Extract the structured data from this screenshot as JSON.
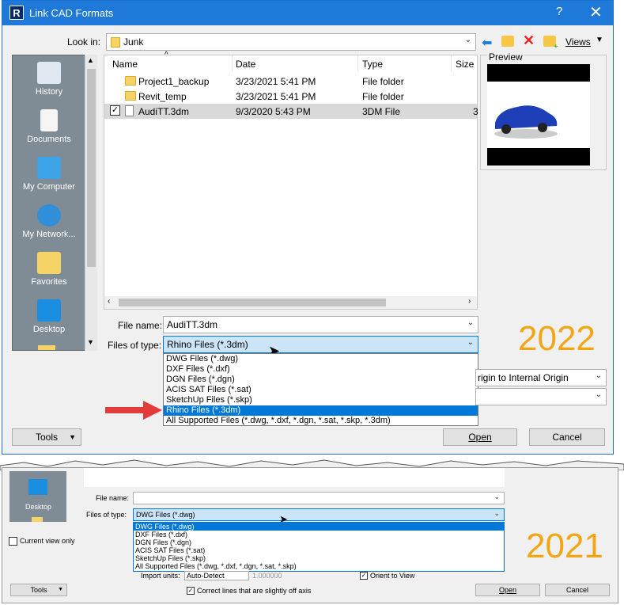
{
  "dialog2022": {
    "title": "Link CAD Formats",
    "help": "?",
    "close": "✕",
    "look_in_label": "Look in:",
    "look_in_value": "Junk",
    "views_label": "Views",
    "preview_label": "Preview",
    "places": [
      "History",
      "Documents",
      "My Computer",
      "My Network...",
      "Favorites",
      "Desktop"
    ],
    "columns": [
      "Name",
      "Date",
      "Type",
      "Size"
    ],
    "files": [
      {
        "name": "Project1_backup",
        "date": "3/23/2021 5:41 PM",
        "type": "File folder",
        "size": ""
      },
      {
        "name": "Revit_temp",
        "date": "3/23/2021 5:41 PM",
        "type": "File folder",
        "size": ""
      },
      {
        "name": "AudiTT.3dm",
        "date": "9/3/2020 5:43 PM",
        "type": "3DM File",
        "size": "3"
      }
    ],
    "file_name_label": "File name:",
    "file_name_value": "AudiTT.3dm",
    "files_of_type_label": "Files of type:",
    "files_of_type_value": "Rhino Files  (*.3dm)",
    "type_options": [
      "DWG Files  (*.dwg)",
      "DXF Files  (*.dxf)",
      "DGN Files  (*.dgn)",
      "ACIS SAT Files  (*.sat)",
      "SketchUp Files  (*.skp)",
      "Rhino Files  (*.3dm)",
      "All Supported Files  (*.dwg, *.dxf, *.dgn, *.sat, *.skp, *.3dm)"
    ],
    "positioning_value": "rigin to Internal Origin",
    "tools_label": "Tools",
    "open_label": "Open",
    "cancel_label": "Cancel",
    "year": "2022"
  },
  "dialog2021": {
    "place": "Desktop",
    "file_name_label": "File name:",
    "files_of_type_label": "Files of type:",
    "files_of_type_value": "DWG Files  (*.dwg)",
    "type_options": [
      "DWG Files  (*.dwg)",
      "DXF Files  (*.dxf)",
      "DGN Files  (*.dgn)",
      "ACIS SAT Files  (*.sat)",
      "SketchUp Files  (*.skp)",
      "All Supported Files  (*.dwg, *.dxf, *.dgn, *.sat, *.skp)"
    ],
    "current_view_only": "Current view only",
    "import_units_label": "Import units:",
    "import_units_value": "Auto-Detect",
    "scale_value": "1.000000",
    "orient_to_view": "Orient to View",
    "correct_lines": "Correct lines that are slightly off axis",
    "tools_label": "Tools",
    "open_label": "Open",
    "cancel_label": "Cancel",
    "year": "2021"
  },
  "colors": {
    "accent": "#1e79d9",
    "selected": "#0078d7",
    "year_label": "#f3a614",
    "arrow": "#e23b3b"
  }
}
